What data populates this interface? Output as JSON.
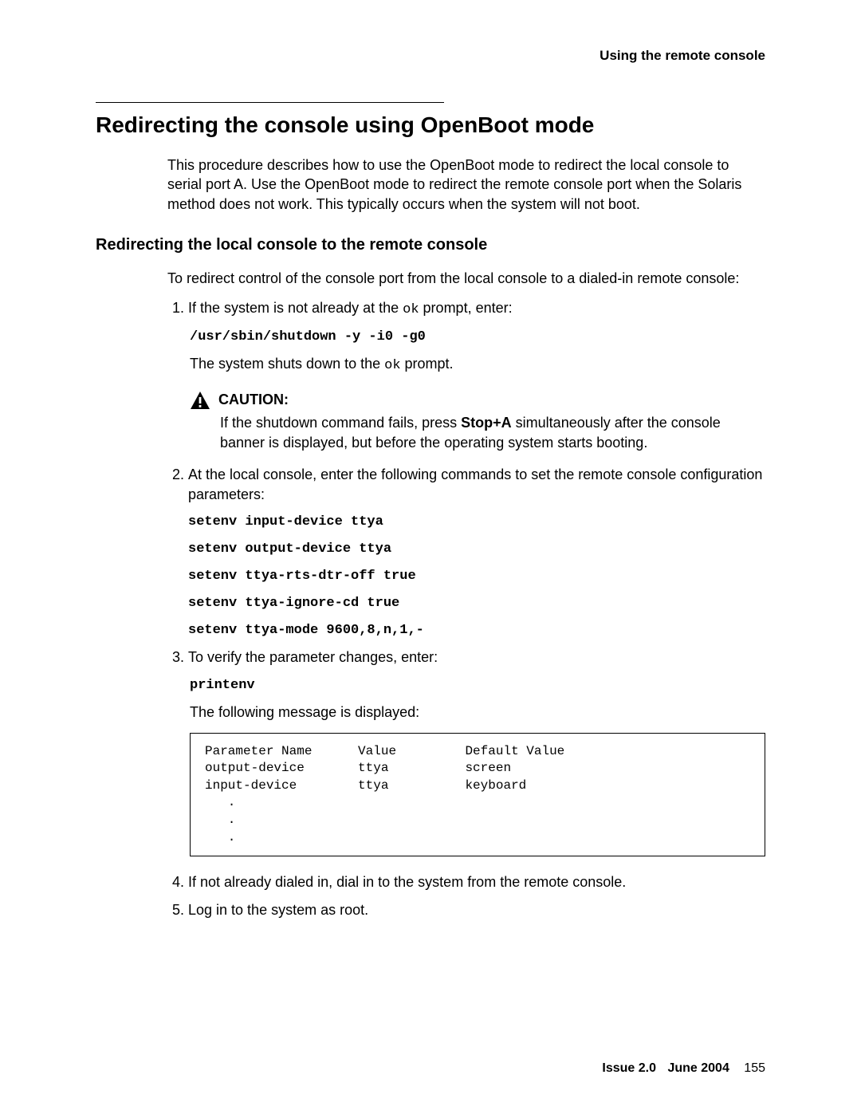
{
  "runningHead": "Using the remote console",
  "sectionTitle": "Redirecting the console using OpenBoot mode",
  "intro": "This procedure describes how to use the OpenBoot mode to redirect the local console to serial port A. Use the OpenBoot mode to redirect the remote console port when the Solaris method does not work. This typically occurs when the system will not boot.",
  "subheading": "Redirecting the local console to the remote console",
  "lead": "To redirect control of the console port from the local console to a dialed-in remote console:",
  "step1": {
    "pre": "If the system is not already at the ",
    "ok": "ok",
    "post": " prompt, enter:",
    "cmd": "/usr/sbin/shutdown -y -i0 -g0",
    "result_pre": "The system shuts down to the ",
    "result_ok": "ok",
    "result_post": " prompt."
  },
  "caution": {
    "label": "CAUTION:",
    "text_pre": "If the shutdown command fails, press ",
    "key": "Stop+A",
    "text_post": " simultaneously after the console banner is displayed, but before the operating system starts booting."
  },
  "step2": {
    "text": "At the local console, enter the following commands to set the remote console configuration parameters:",
    "cmds": [
      "setenv input-device ttya",
      "setenv output-device ttya",
      "setenv ttya-rts-dtr-off true",
      "setenv ttya-ignore-cd true",
      "setenv ttya-mode 9600,8,n,1,-"
    ]
  },
  "step3": {
    "text": "To verify the parameter changes, enter:",
    "cmd": "printenv",
    "result": "The following message is displayed:",
    "output": "Parameter Name      Value         Default Value\noutput-device       ttya          screen\ninput-device        ttya          keyboard\n   .\n   .\n   ."
  },
  "step4": "If not already dialed in, dial in to the system from the remote console.",
  "step5": "Log in to the system as root.",
  "footer": {
    "issue": "Issue 2.0",
    "date": "June 2004",
    "page": "155"
  }
}
